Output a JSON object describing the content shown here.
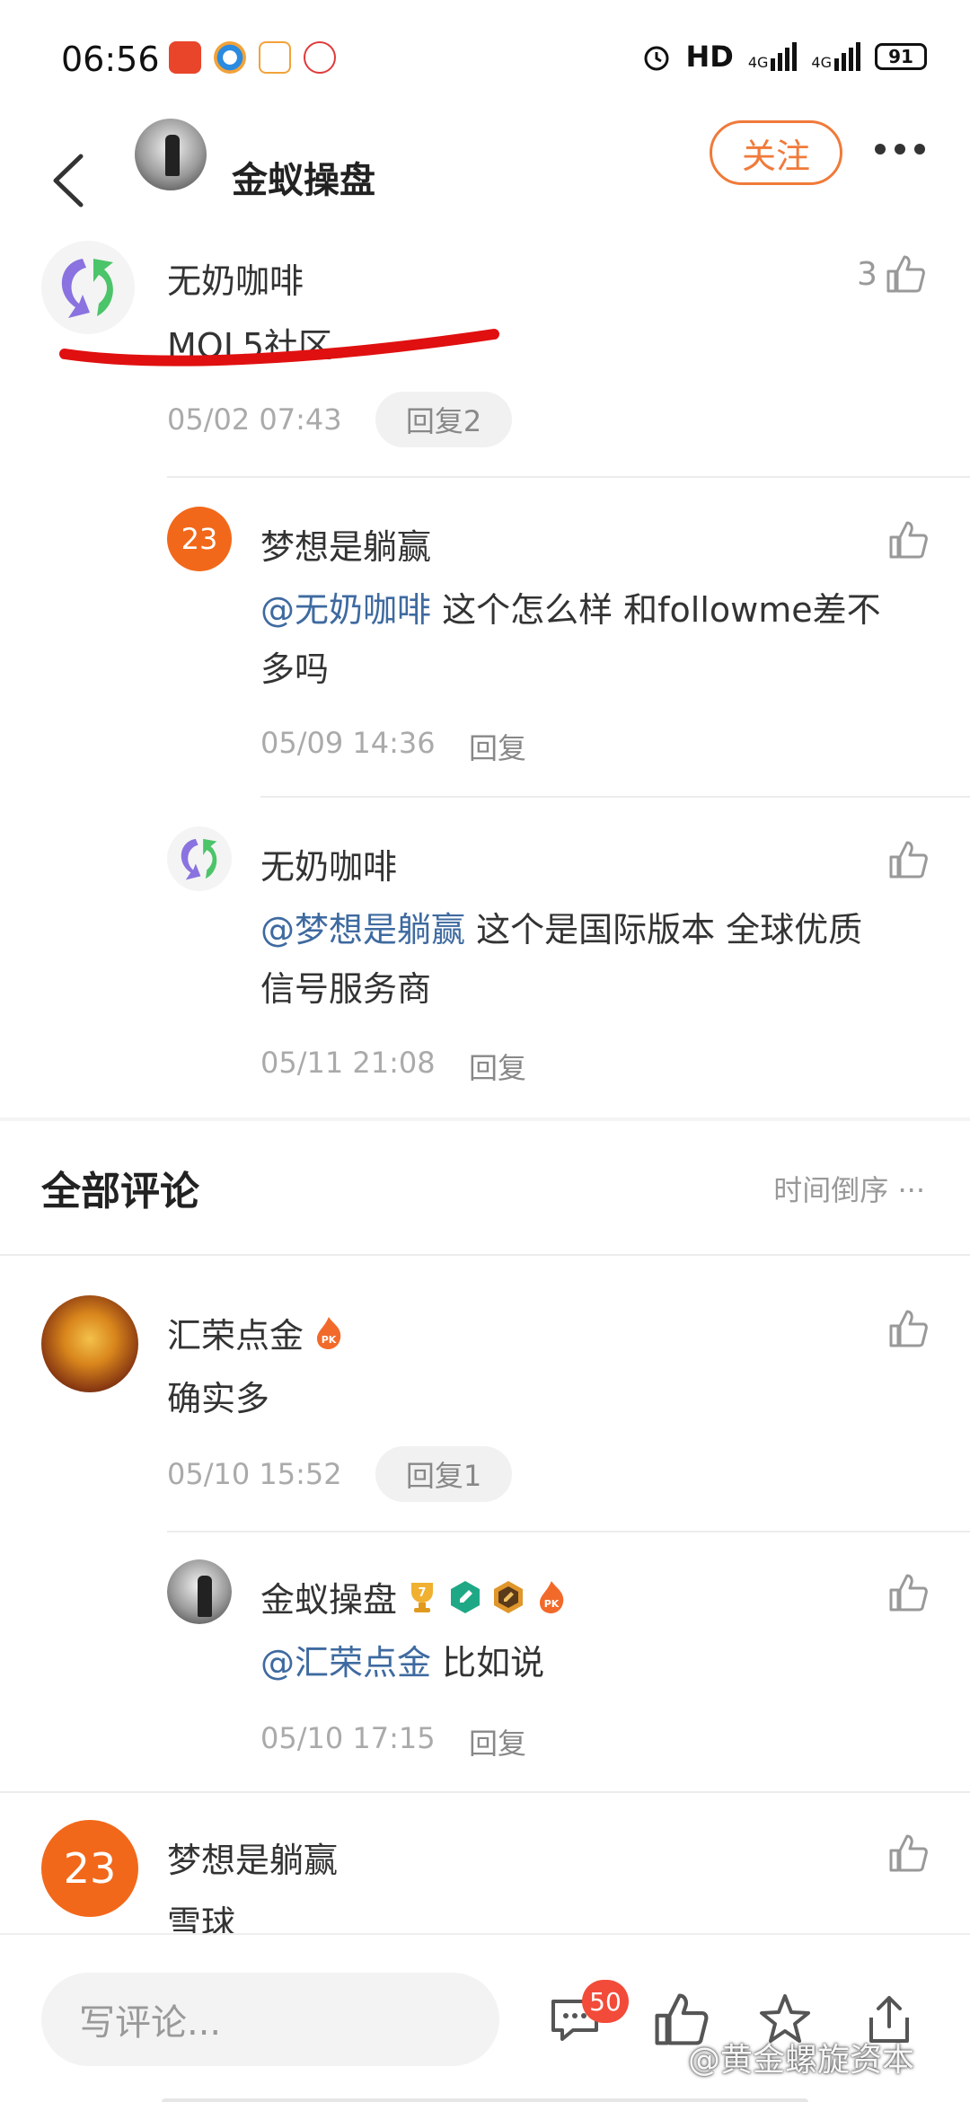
{
  "status_bar": {
    "time": "06:56",
    "network": "HD",
    "signal1": "4G",
    "signal2": "4G",
    "battery": "91"
  },
  "header": {
    "title": "金蚁操盘",
    "follow_label": "关注"
  },
  "top_comment": {
    "author": "无奶咖啡",
    "text": "MQL5社区",
    "time": "05/02 07:43",
    "reply_label": "回复2",
    "likes": "3",
    "replies": [
      {
        "author": "梦想是躺赢",
        "avatar_text": "23",
        "mention": "@无奶咖啡",
        "text_line1": " 这个怎么样 和followme差不",
        "text_line2": "多吗",
        "time": "05/09 14:36",
        "reply_label": "回复"
      },
      {
        "author": "无奶咖啡",
        "mention": "@梦想是躺赢",
        "text_line1": " 这个是国际版本 全球优质",
        "text_line2": "信号服务商",
        "time": "05/11 21:08",
        "reply_label": "回复"
      }
    ]
  },
  "all_comments": {
    "title": "全部评论",
    "sort_label": "时间倒序 ···"
  },
  "comments": [
    {
      "author": "汇荣点金",
      "text": "确实多",
      "time": "05/10 15:52",
      "reply_label": "回复1",
      "replies": [
        {
          "author": "金蚁操盘",
          "badge_number": "7",
          "mention": "@汇荣点金",
          "text": " 比如说",
          "time": "05/10 17:15",
          "reply_label": "回复"
        }
      ]
    },
    {
      "author": "梦想是躺赢",
      "avatar_text": "23",
      "text": "雪球"
    }
  ],
  "bottom_bar": {
    "input_placeholder": "写评论...",
    "comment_count": "50",
    "watermark": "@黄金螺旋资本"
  },
  "colors": {
    "accent": "#f07a3a",
    "mention": "#3e6aa0",
    "badge_red": "#f24b3a",
    "underline_red": "#e01010"
  }
}
